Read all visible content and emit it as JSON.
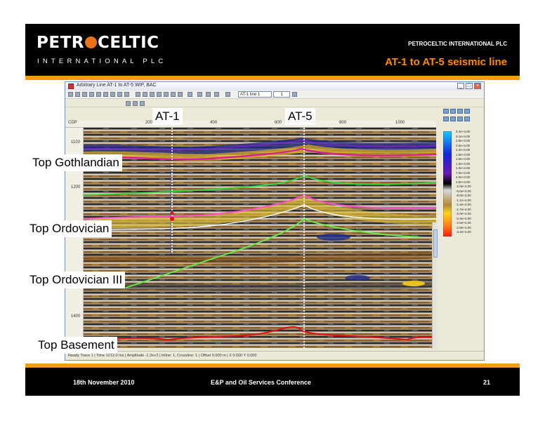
{
  "header": {
    "logo_main_left": "PETR",
    "logo_main_right": "CELTIC",
    "logo_sub": "INTERNATIONAL PLC",
    "company": "PETROCELTIC INTERNATIONAL PLC",
    "title": "AT-1 to AT-5 seismic line",
    "accent_color": "#f39c12",
    "title_color": "#ff8a00"
  },
  "window": {
    "title": "Arbitrary Line AT-1 to AT-5 WIP, BAC",
    "buttons": [
      "minimize",
      "maximize",
      "close"
    ],
    "line_select": "AT-1 line 1",
    "page_field": "1",
    "top_axis_ticks": [
      "200",
      "400",
      "600",
      "800",
      "1000"
    ],
    "left_axis_ticks": [
      "1100",
      "1200",
      "1400"
    ],
    "colorbar_labels": [
      "3.4e+4.00",
      "3.1e+4.00",
      "2.8e+4.00",
      "2.5e+4.00",
      "2.2e+4.00",
      "1.9e+4.00",
      "1.6e+4.00",
      "1.3e+4.00",
      "1.0e+4.00",
      "7.0e+3.00",
      "4.0e+3.00",
      "1.0e+3.00",
      "-2.0e+3.00",
      "-5.0e+3.00",
      "-8.0e+3.00",
      "-1.1e+4.00",
      "-1.4e+4.00",
      "-1.7e+4.00",
      "-2.0e+4.00",
      "-2.3e+4.00",
      "-2.6e+4.00",
      "-2.9e+4.00",
      "-3.2e+4.00"
    ],
    "status": "Ready     Trace 1  |  Time 1212.0 ms  |  Amplitude -1.2e+3  |  Inline: 1, Crossline: 1  |  Offset 0.000 m  |  X 0.000  Y 0.000"
  },
  "wells": [
    {
      "label": "AT-1"
    },
    {
      "label": "AT-5"
    }
  ],
  "horizons": [
    {
      "label": "Top Gothlandian",
      "color": "#d81b9a"
    },
    {
      "label": "Top Ordovician",
      "color": "#ff4fd0"
    },
    {
      "label": "Top Ordovician III",
      "color": "#66ee44"
    },
    {
      "label": "Top Basement",
      "color": "#e01010"
    }
  ],
  "footer": {
    "date": "18th November 2010",
    "conference": "E&P and Oil Services Conference",
    "page": "21"
  }
}
